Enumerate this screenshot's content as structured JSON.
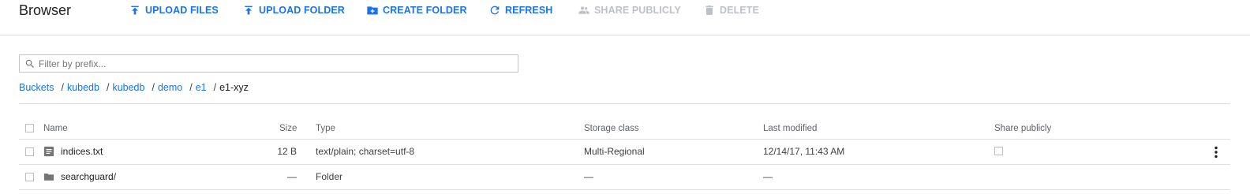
{
  "app": {
    "title": "Browser"
  },
  "toolbar": {
    "upload_files": "UPLOAD FILES",
    "upload_folder": "UPLOAD FOLDER",
    "create_folder": "CREATE FOLDER",
    "refresh": "REFRESH",
    "share_publicly": "SHARE PUBLICLY",
    "delete": "DELETE",
    "accent_color": "#1a73e8",
    "disabled_color": "#bdc1c6"
  },
  "filter": {
    "placeholder": "Filter by prefix...",
    "value": "",
    "icon": "search-icon"
  },
  "breadcrumb": {
    "items": [
      "Buckets",
      "kubedb",
      "kubedb",
      "demo",
      "e1"
    ],
    "separator": "/",
    "current": "e1-xyz"
  },
  "table": {
    "columns": {
      "name": "Name",
      "size": "Size",
      "type": "Type",
      "storage_class": "Storage class",
      "last_modified": "Last modified",
      "share_publicly": "Share publicly"
    },
    "rows": [
      {
        "icon": "text-file-icon",
        "name": "indices.txt",
        "size": "12 B",
        "type": "text/plain; charset=utf-8",
        "storage_class": "Multi-Regional",
        "last_modified": "12/14/17, 11:43 AM",
        "share_publicly": false
      },
      {
        "icon": "folder-icon",
        "name": "searchguard/",
        "size": "—",
        "type": "Folder",
        "storage_class": "—",
        "last_modified": "—"
      }
    ]
  }
}
